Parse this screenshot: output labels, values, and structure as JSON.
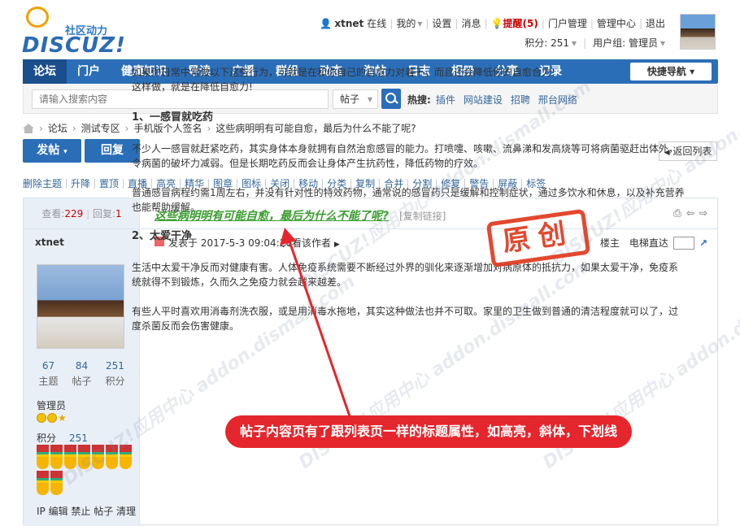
{
  "logo": {
    "tagline": "社区动力",
    "wordmark": "DISCUZ!"
  },
  "topbar": {
    "username": "xtnet",
    "online": "在线",
    "my": "我的",
    "settings": "设置",
    "messages": "消息",
    "reminder": "提醒(5)",
    "portal_admin": "门户管理",
    "admin_center": "管理中心",
    "logout": "退出",
    "points_label": "积分: 251",
    "usergroup_label": "用户组: 管理员"
  },
  "nav": {
    "items": [
      "论坛",
      "门户",
      "健康知识",
      "导读",
      "广播",
      "群组",
      "动态",
      "淘帖",
      "日志",
      "相册",
      "分享",
      "记录"
    ],
    "quick_nav": "快捷导航"
  },
  "search": {
    "placeholder": "请输入搜索内容",
    "type": "帖子",
    "hot_label": "热搜:",
    "hot_words": [
      "插件",
      "网站建设",
      "招聘",
      "邢台网络"
    ]
  },
  "breadcrumb": [
    "论坛",
    "测试专区",
    "手机版个人签名",
    "这些病明明有可能自愈，最后为什么不能了呢?"
  ],
  "buttons": {
    "post": "发帖",
    "reply": "回复",
    "back": "返回列表"
  },
  "mod_actions": [
    "删除主题",
    "升降",
    "置顶",
    "直播",
    "高亮",
    "精华",
    "图章",
    "图标",
    "关闭",
    "移动",
    "分类",
    "复制",
    "合并",
    "分割",
    "修复",
    "警告",
    "屏蔽",
    "标签"
  ],
  "thread": {
    "views_label": "查看:",
    "views": "229",
    "replies_label": "回复:",
    "replies": "1",
    "title": "这些病明明有可能自愈，最后为什么不能了呢?",
    "copy_link": "[复制链接]"
  },
  "author": {
    "name": "xtnet",
    "stats": [
      {
        "value": "67",
        "label": "主题"
      },
      {
        "value": "84",
        "label": "帖子"
      },
      {
        "value": "251",
        "label": "积分"
      }
    ],
    "role": "管理员",
    "credits_label": "积分",
    "credits": "251",
    "admin_tools": "IP 编辑 禁止 帖子 清理"
  },
  "post": {
    "posted_at": "发表于 2017-5-3 09:04:20",
    "only_author": "只看该作者",
    "floor_label": "楼主",
    "elevator": "电梯直达",
    "paragraphs": [
      {
        "type": "p",
        "text": "如果你日常中常做以下这些行为，可就是在和你自己的自愈力对着干，而且还会降低你的自愈合力!"
      },
      {
        "type": "p",
        "text": "这样做，就是在降低自愈力!"
      },
      {
        "type": "h",
        "text": "1、一感冒就吃药"
      },
      {
        "type": "p",
        "text": "不少人一感冒就赶紧吃药，其实身体本身就拥有自然治愈感冒的能力。打喷嚏、咳嗽、流鼻涕和发高烧等可将病菌驱赶出体外，令病菌的破坏力减弱。但是长期吃药反而会让身体产生抗药性，降低药物的疗效。"
      },
      {
        "type": "p",
        "text": "普通感冒病程约需1周左右，并没有针对性的特效药物，通常说的感冒药只是缓解和控制症状，通过多饮水和休息，以及补充营养也能帮助缓解。"
      },
      {
        "type": "h",
        "text": "2、太爱干净"
      },
      {
        "type": "p",
        "text": "生活中太爱干净反而对健康有害。人体免疫系统需要不断经过外界的驯化来逐渐增加对病原体的抵抗力，如果太爱干净，免疫系统就得不到锻炼，久而久之免疫力就会越来越差。"
      },
      {
        "type": "p",
        "text": "有些人平时喜欢用消毒剂洗衣服，或是用消毒水拖地，其实这种做法也并不可取。家里的卫生做到普通的清洁程度就可以了，过度杀菌反而会伤害健康。"
      }
    ]
  },
  "stamp_text": "原创",
  "callout": "帖子内容页有了跟列表页一样的标题属性，如高亮，斜体，下划线",
  "watermark": "DISCUZ!应用中心 addon.dismall.com",
  "colors": {
    "nav": "#2b6eb8",
    "title_highlight": "#3a9e2f",
    "callout": "#e5262c",
    "stamp": "#e03a1f"
  }
}
